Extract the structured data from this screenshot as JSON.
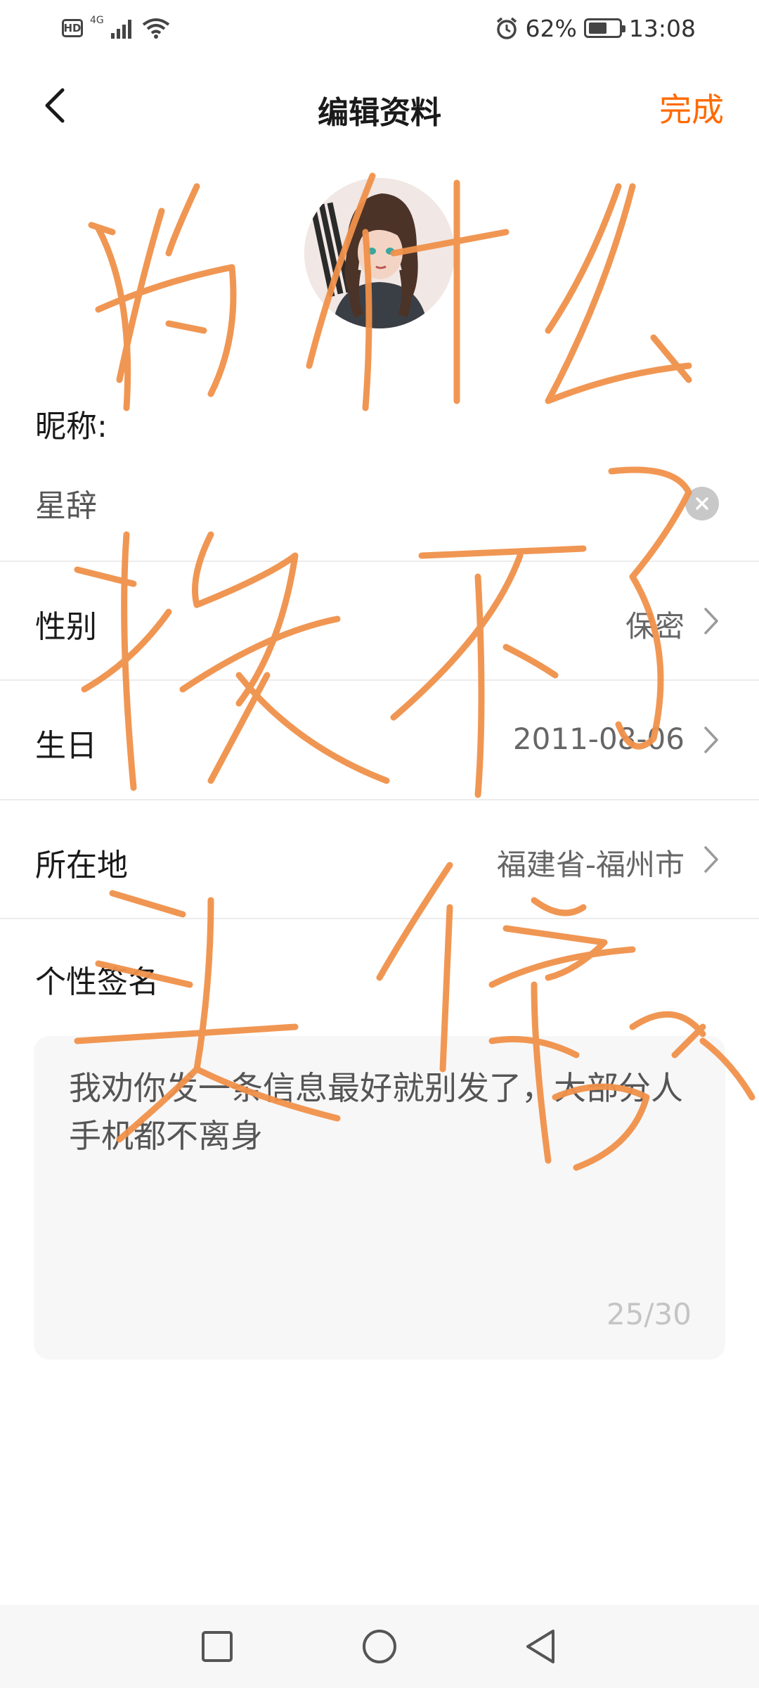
{
  "status_bar": {
    "network_type": "4G",
    "battery_percent": "62%",
    "battery_level": 0.62,
    "time": "13:08",
    "hd_label": "HD"
  },
  "header": {
    "title": "编辑资料",
    "done_label": "完成"
  },
  "profile": {
    "nickname_label": "昵称:",
    "nickname_value": "星辞",
    "rows": [
      {
        "label": "性别",
        "value": "保密"
      },
      {
        "label": "生日",
        "value": "2011-08-06"
      },
      {
        "label": "所在地",
        "value": "福建省-福州市"
      }
    ],
    "signature_label": "个性签名",
    "signature_text": "我劝你发一条信息最好就别发了，大部分人手机都不离身",
    "signature_count": "25/30"
  },
  "overlay": {
    "scribble_color": "#f0914a",
    "handwritten_text": "为什么换不了头像"
  },
  "colors": {
    "accent": "#ff6a00",
    "scribble": "#f0914a"
  },
  "icons": {
    "back": "back-arrow-icon",
    "clear": "clear-icon",
    "chevron": "chevron-right-icon",
    "nav_recents": "square-icon",
    "nav_home": "circle-icon",
    "nav_back": "triangle-icon"
  }
}
